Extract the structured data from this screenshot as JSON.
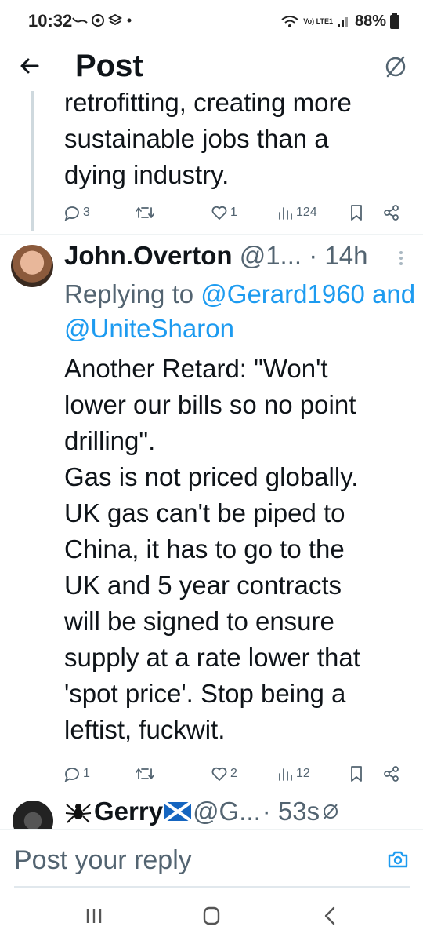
{
  "status_bar": {
    "time": "10:32",
    "network": "Vo) LTE1",
    "battery": "88%"
  },
  "header": {
    "title": "Post"
  },
  "previous_post": {
    "text_lines": [
      "retrofitting, creating more",
      "sustainable jobs than a",
      "dying industry."
    ],
    "replies": "3",
    "likes": "1",
    "views": "124"
  },
  "main_post": {
    "author_name": "John.Overton",
    "handle": "@1...",
    "time": "· 14h",
    "replying_prefix": "Replying to",
    "mention_1": "@Gerard1960 and",
    "mention_2": "@UniteSharon",
    "text_lines": [
      "Another Retard: \"Won't",
      "lower our bills so no point",
      "drilling\".",
      "Gas is not priced globally.",
      "UK gas can't be piped to",
      "China, it has to go to the",
      "UK and 5 year contracts",
      "will be signed to ensure",
      "supply at a rate lower that",
      "'spot price'. Stop being a",
      "leftist, fuckwit."
    ],
    "replies": "1",
    "likes": "2",
    "views": "12"
  },
  "next_post": {
    "author_name": "Gerry",
    "handle": "@G...",
    "time": "· 53s"
  },
  "reply_bar": {
    "placeholder": "Post your reply"
  },
  "colors": {
    "accent": "#1d9bf0",
    "text": "#0f1419",
    "secondary": "#536471"
  }
}
